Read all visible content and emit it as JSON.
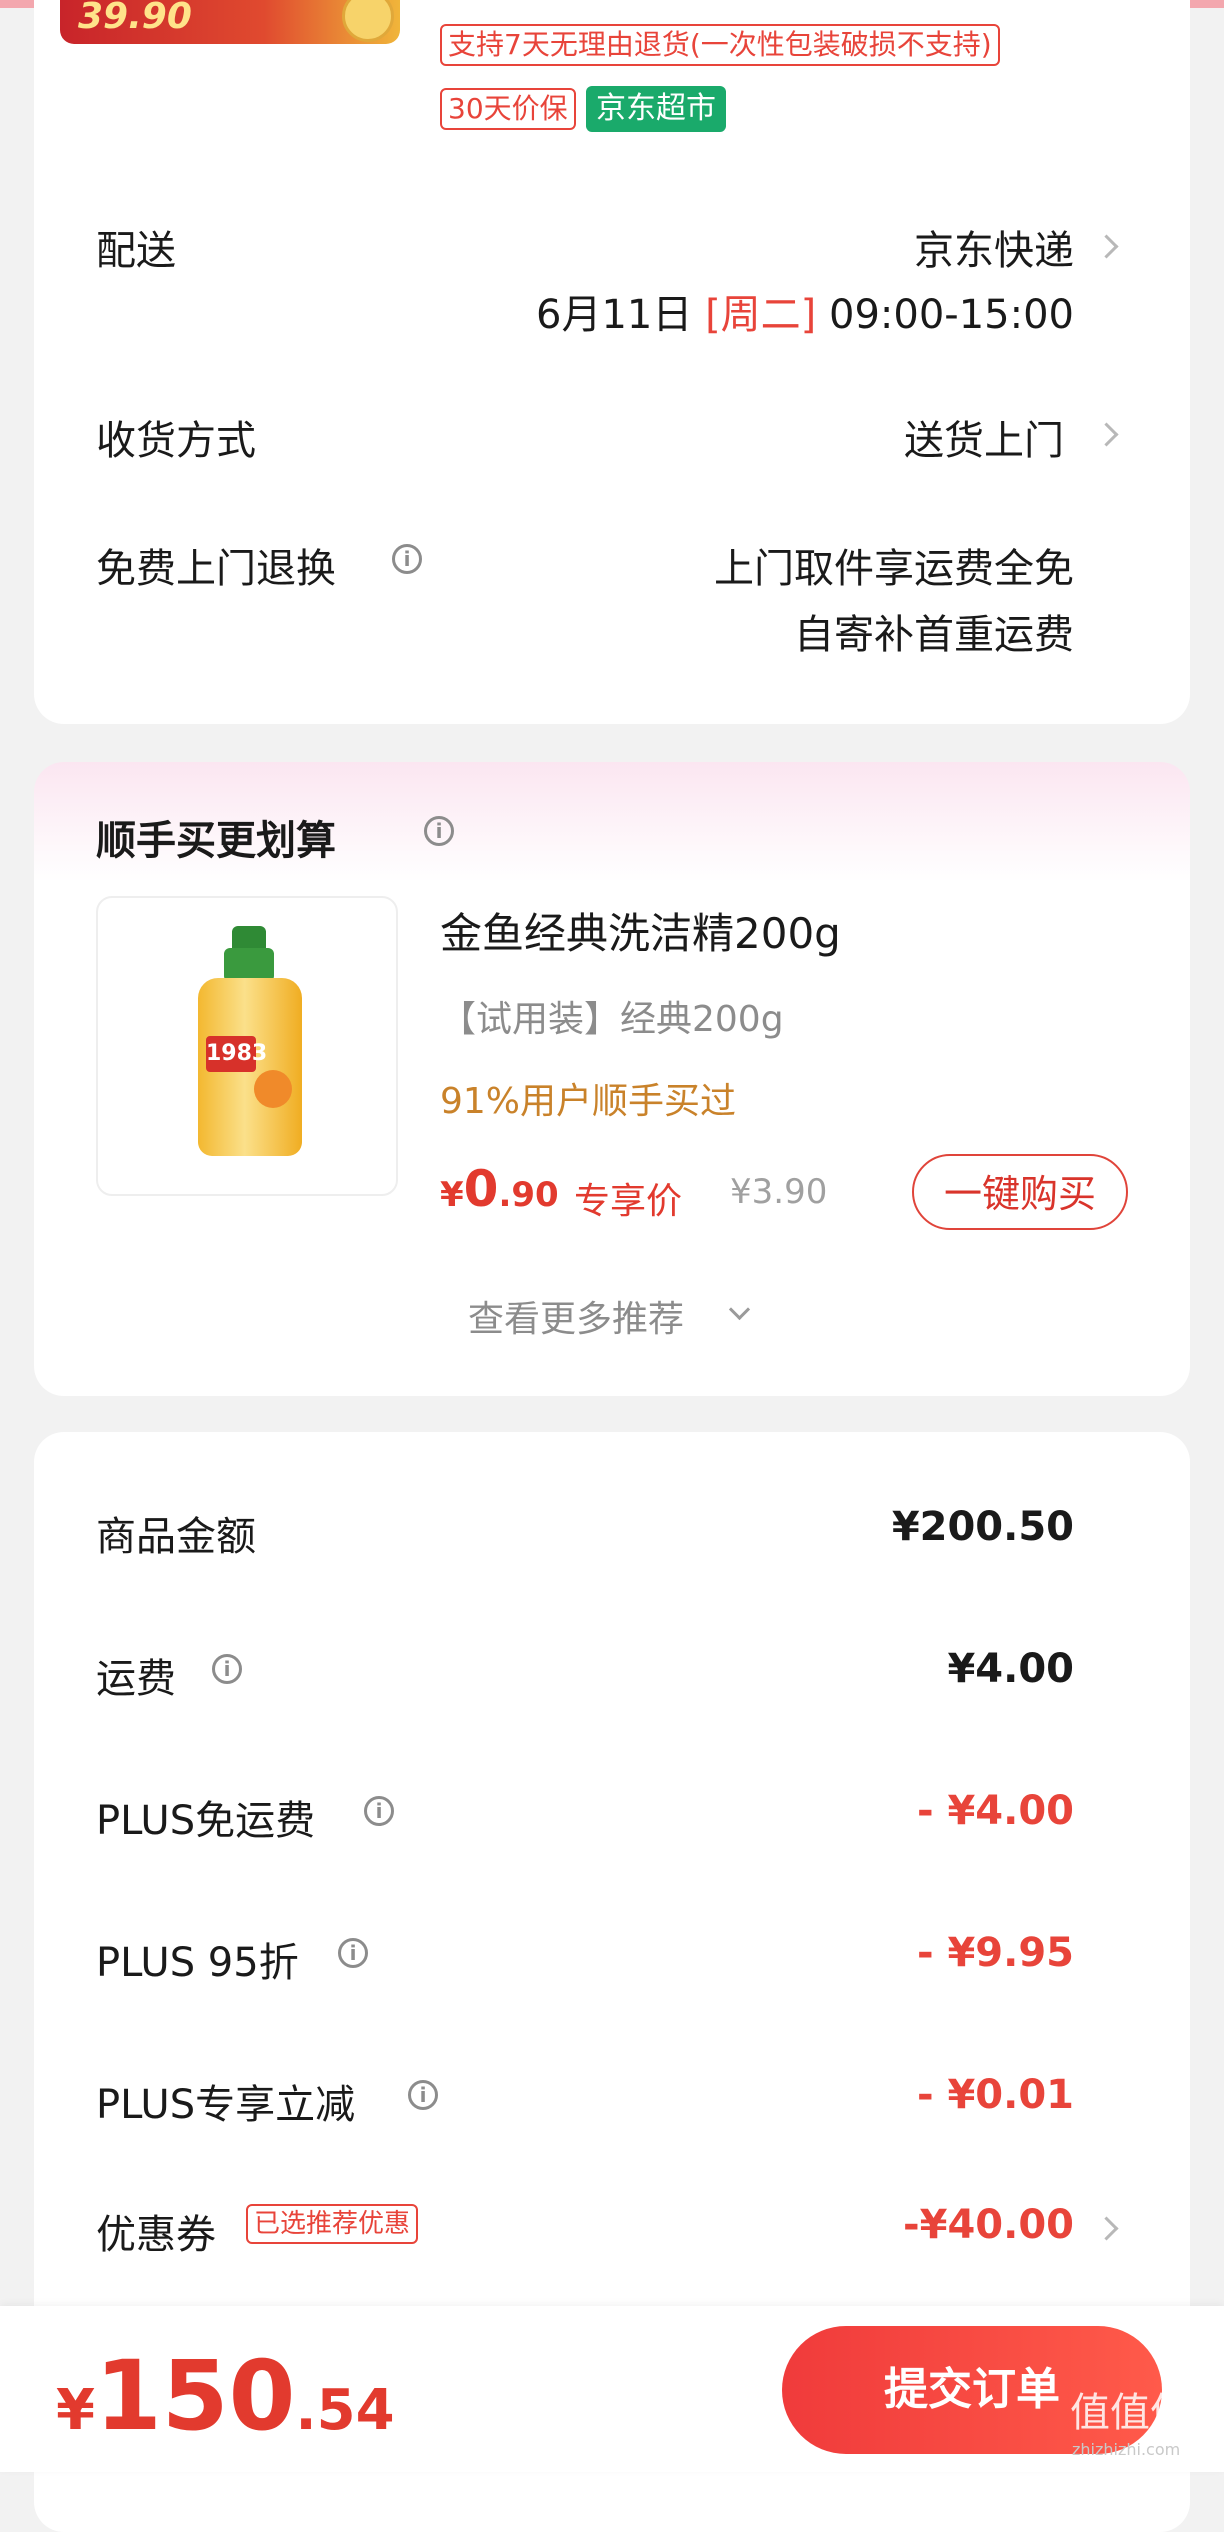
{
  "product": {
    "thumb_price": "39.90",
    "tags": {
      "return_policy": "支持7天无理由退货(一次性包装破损不支持)",
      "price_protect": "30天价保",
      "store": "京东超市"
    }
  },
  "delivery": {
    "label": "配送",
    "carrier": "京东快递",
    "date": "6月11日",
    "weekday": "[周二]",
    "time_window": "09:00-15:00"
  },
  "receive": {
    "label": "收货方式",
    "value": "送货上门"
  },
  "free_return": {
    "label": "免费上门退换",
    "line1": "上门取件享运费全免",
    "line2": "自寄补首重运费"
  },
  "addon": {
    "title": "顺手买更划算",
    "item": {
      "name": "金鱼经典洗洁精200g",
      "spec": "【试用装】经典200g",
      "stat": "91%用户顺手买过",
      "price_currency": "¥",
      "price_int": "0",
      "price_dec": ".90",
      "price_label": "专享价",
      "orig_price": "¥3.90",
      "image_text": "1983",
      "buy_button": "一键购买"
    },
    "see_more": "查看更多推荐"
  },
  "summary": {
    "goods_label": "商品金额",
    "goods_value": "¥200.50",
    "shipping_label": "运费",
    "shipping_value": "¥4.00",
    "plus_free_ship_label": "PLUS免运费",
    "plus_free_ship_value": "- ¥4.00",
    "plus_discount_label": "PLUS 95折",
    "plus_discount_value": "- ¥9.95",
    "plus_reduce_label": "PLUS专享立减",
    "plus_reduce_value": "- ¥0.01",
    "coupon_label": "优惠券",
    "coupon_tag": "已选推荐优惠",
    "coupon_value": "-¥40.00"
  },
  "bottom": {
    "currency": "¥",
    "total_int": "150",
    "total_dec": ".54",
    "submit_label": "提交订单",
    "watermark": "值值值",
    "watermark_sub": "zhizhizhi.com"
  },
  "colors": {
    "accent_red": "#e8443a",
    "green_tag": "#1aaa6b",
    "stat_orange": "#c9822a",
    "page_bg": "#f2f2f2"
  }
}
